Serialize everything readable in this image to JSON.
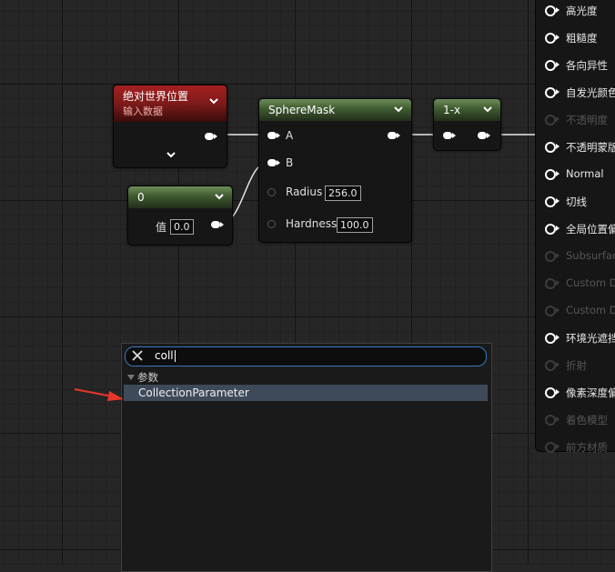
{
  "nodes": {
    "world_position": {
      "title": "绝对世界位置",
      "subtitle": "输入数据"
    },
    "constant": {
      "title": "0",
      "value_label": "值",
      "value": "0.0"
    },
    "sphere_mask": {
      "title": "SphereMask",
      "pin_a": "A",
      "pin_b": "B",
      "radius_label": "Radius",
      "radius_value": "256.0",
      "hardness_label": "Hardness",
      "hardness_value": "100.0"
    },
    "one_minus": {
      "title": "1-x"
    }
  },
  "material_panel": {
    "items": [
      {
        "label": "高光度",
        "enabled": true
      },
      {
        "label": "粗糙度",
        "enabled": true
      },
      {
        "label": "各向异性",
        "enabled": true
      },
      {
        "label": "自发光颜色",
        "enabled": true
      },
      {
        "label": "不透明度",
        "enabled": false
      },
      {
        "label": "不透明蒙版",
        "enabled": true
      },
      {
        "label": "Normal",
        "enabled": true
      },
      {
        "label": "切线",
        "enabled": true
      },
      {
        "label": "全局位置偏移",
        "enabled": true
      },
      {
        "label": "Subsurface",
        "enabled": false
      },
      {
        "label": "Custom Da",
        "enabled": false
      },
      {
        "label": "Custom Da",
        "enabled": false
      },
      {
        "label": "环境光遮挡",
        "enabled": true
      },
      {
        "label": "折射",
        "enabled": false
      },
      {
        "label": "像素深度偏移",
        "enabled": true
      },
      {
        "label": "着色模型",
        "enabled": false
      },
      {
        "label": "前方材质",
        "enabled": false
      }
    ]
  },
  "search_popup": {
    "query": "coll",
    "category": "参数",
    "result": "CollectionParameter"
  },
  "colors": {
    "accent": "#3a78c8",
    "node_green": "#4f6b3f",
    "node_red": "#8b1c1c",
    "arrow": "#e8352a",
    "selection": "#3e4a5a"
  }
}
